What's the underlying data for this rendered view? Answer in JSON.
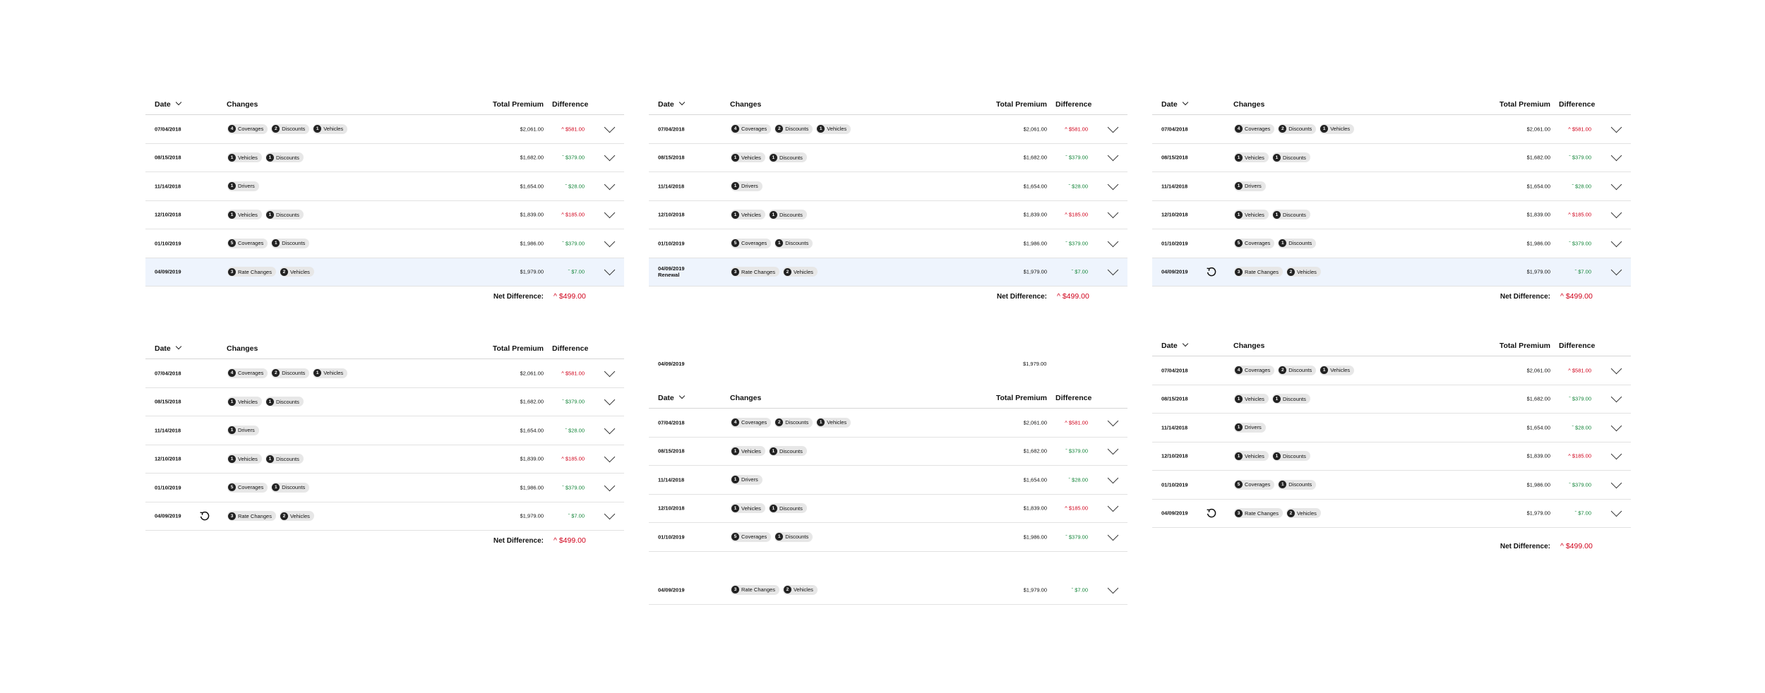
{
  "headers": {
    "date": "Date",
    "changes": "Changes",
    "total_premium": "Total Premium",
    "difference": "Difference"
  },
  "net_label": "Net Difference:",
  "colors": {
    "increase": "#d0021b",
    "decrease": "#14853a",
    "highlight_row": "#eef4fd"
  },
  "panels": [
    {
      "rows": [
        {
          "date": "07/04/2018",
          "chips": [
            {
              "n": "4",
              "label": "Coverages"
            },
            {
              "n": "2",
              "label": "Discounts"
            },
            {
              "n": "1",
              "label": "Vehicles"
            }
          ],
          "premium": "$2,061.00",
          "diff": "^ $581.00"
        },
        {
          "date": "08/15/2018",
          "chips": [
            {
              "n": "1",
              "label": "Vehicles"
            },
            {
              "n": "1",
              "label": "Discounts"
            }
          ],
          "premium": "$1,682.00",
          "diff": "ˇ $379.00"
        },
        {
          "date": "11/14/2018",
          "chips": [
            {
              "n": "1",
              "label": "Drivers"
            }
          ],
          "premium": "$1,654.00",
          "diff": "ˇ $28.00"
        },
        {
          "date": "12/10/2018",
          "chips": [
            {
              "n": "1",
              "label": "Vehicles"
            },
            {
              "n": "1",
              "label": "Discounts"
            }
          ],
          "premium": "$1,839.00",
          "diff": "^ $185.00"
        },
        {
          "date": "01/10/2019",
          "chips": [
            {
              "n": "5",
              "label": "Coverages"
            },
            {
              "n": "1",
              "label": "Discounts"
            }
          ],
          "premium": "$1,986.00",
          "diff": "ˇ $379.00"
        },
        {
          "date": "04/09/2019",
          "chips": [
            {
              "n": "3",
              "label": "Rate Changes"
            },
            {
              "n": "2",
              "label": "Vehicles"
            }
          ],
          "premium": "$1,979.00",
          "diff": "ˇ $7.00"
        }
      ],
      "net_value": "^ $499.00"
    },
    {
      "rows": [
        {
          "date": "07/04/2018",
          "chips": [
            {
              "n": "4",
              "label": "Coverages"
            },
            {
              "n": "2",
              "label": "Discounts"
            },
            {
              "n": "1",
              "label": "Vehicles"
            }
          ],
          "premium": "$2,061.00",
          "diff": "^ $581.00"
        },
        {
          "date": "08/15/2018",
          "chips": [
            {
              "n": "1",
              "label": "Vehicles"
            },
            {
              "n": "1",
              "label": "Discounts"
            }
          ],
          "premium": "$1,682.00",
          "diff": "ˇ $379.00"
        },
        {
          "date": "11/14/2018",
          "chips": [
            {
              "n": "1",
              "label": "Drivers"
            }
          ],
          "premium": "$1,654.00",
          "diff": "ˇ $28.00"
        },
        {
          "date": "12/10/2018",
          "chips": [
            {
              "n": "1",
              "label": "Vehicles"
            },
            {
              "n": "1",
              "label": "Discounts"
            }
          ],
          "premium": "$1,839.00",
          "diff": "^ $185.00"
        },
        {
          "date": "01/10/2019",
          "chips": [
            {
              "n": "5",
              "label": "Coverages"
            },
            {
              "n": "1",
              "label": "Discounts"
            }
          ],
          "premium": "$1,986.00",
          "diff": "ˇ $379.00"
        },
        {
          "date": "04/09/2019",
          "date2": "Renewal",
          "chips": [
            {
              "n": "3",
              "label": "Rate Changes"
            },
            {
              "n": "2",
              "label": "Vehicles"
            }
          ],
          "premium": "$1,979.00",
          "diff": "ˇ $7.00"
        }
      ],
      "net_value": "^ $499.00"
    },
    {
      "rows": [
        {
          "date": "07/04/2018",
          "chips": [
            {
              "n": "4",
              "label": "Coverages"
            },
            {
              "n": "2",
              "label": "Discounts"
            },
            {
              "n": "1",
              "label": "Vehicles"
            }
          ],
          "premium": "$2,061.00",
          "diff": "^ $581.00"
        },
        {
          "date": "08/15/2018",
          "chips": [
            {
              "n": "1",
              "label": "Vehicles"
            },
            {
              "n": "1",
              "label": "Discounts"
            }
          ],
          "premium": "$1,682.00",
          "diff": "ˇ $379.00"
        },
        {
          "date": "11/14/2018",
          "chips": [
            {
              "n": "1",
              "label": "Drivers"
            }
          ],
          "premium": "$1,654.00",
          "diff": "ˇ $28.00"
        },
        {
          "date": "12/10/2018",
          "chips": [
            {
              "n": "1",
              "label": "Vehicles"
            },
            {
              "n": "1",
              "label": "Discounts"
            }
          ],
          "premium": "$1,839.00",
          "diff": "^ $185.00"
        },
        {
          "date": "01/10/2019",
          "chips": [
            {
              "n": "5",
              "label": "Coverages"
            },
            {
              "n": "1",
              "label": "Discounts"
            }
          ],
          "premium": "$1,986.00",
          "diff": "ˇ $379.00"
        },
        {
          "date": "04/09/2019",
          "chips": [
            {
              "n": "3",
              "label": "Rate Changes"
            },
            {
              "n": "2",
              "label": "Vehicles"
            }
          ],
          "premium": "$1,979.00",
          "diff": "ˇ $7.00"
        }
      ],
      "net_value": "^ $499.00"
    },
    {
      "rows": [
        {
          "date": "07/04/2018",
          "chips": [
            {
              "n": "4",
              "label": "Coverages"
            },
            {
              "n": "2",
              "label": "Discounts"
            },
            {
              "n": "1",
              "label": "Vehicles"
            }
          ],
          "premium": "$2,061.00",
          "diff": "^ $581.00"
        },
        {
          "date": "08/15/2018",
          "chips": [
            {
              "n": "1",
              "label": "Vehicles"
            },
            {
              "n": "1",
              "label": "Discounts"
            }
          ],
          "premium": "$1,682.00",
          "diff": "ˇ $379.00"
        },
        {
          "date": "11/14/2018",
          "chips": [
            {
              "n": "1",
              "label": "Drivers"
            }
          ],
          "premium": "$1,654.00",
          "diff": "ˇ $28.00"
        },
        {
          "date": "12/10/2018",
          "chips": [
            {
              "n": "1",
              "label": "Vehicles"
            },
            {
              "n": "1",
              "label": "Discounts"
            }
          ],
          "premium": "$1,839.00",
          "diff": "^ $185.00"
        },
        {
          "date": "01/10/2019",
          "chips": [
            {
              "n": "5",
              "label": "Coverages"
            },
            {
              "n": "1",
              "label": "Discounts"
            }
          ],
          "premium": "$1,986.00",
          "diff": "ˇ $379.00"
        },
        {
          "date": "04/09/2019",
          "chips": [
            {
              "n": "3",
              "label": "Rate Changes"
            },
            {
              "n": "2",
              "label": "Vehicles"
            }
          ],
          "premium": "$1,979.00",
          "diff": "ˇ $7.00"
        }
      ],
      "net_value": "^ $499.00"
    },
    {
      "rows": [
        {
          "date": "07/04/2018",
          "chips": [
            {
              "n": "4",
              "label": "Coverages"
            },
            {
              "n": "2",
              "label": "Discounts"
            },
            {
              "n": "1",
              "label": "Vehicles"
            }
          ],
          "premium": "$2,061.00",
          "diff": "^ $581.00"
        },
        {
          "date": "08/15/2018",
          "chips": [
            {
              "n": "1",
              "label": "Vehicles"
            },
            {
              "n": "1",
              "label": "Discounts"
            }
          ],
          "premium": "$1,682.00",
          "diff": "ˇ $379.00"
        },
        {
          "date": "11/14/2018",
          "chips": [
            {
              "n": "1",
              "label": "Drivers"
            }
          ],
          "premium": "$1,654.00",
          "diff": "ˇ $28.00"
        },
        {
          "date": "12/10/2018",
          "chips": [
            {
              "n": "1",
              "label": "Vehicles"
            },
            {
              "n": "1",
              "label": "Discounts"
            }
          ],
          "premium": "$1,839.00",
          "diff": "^ $185.00"
        },
        {
          "date": "01/10/2019",
          "chips": [
            {
              "n": "5",
              "label": "Coverages"
            },
            {
              "n": "1",
              "label": "Discounts"
            }
          ],
          "premium": "$1,986.00",
          "diff": "ˇ $379.00"
        }
      ],
      "extra_row": {
        "date": "04/09/2019",
        "chips": [
          {
            "n": "3",
            "label": "Rate Changes"
          },
          {
            "n": "2",
            "label": "Vehicles"
          }
        ],
        "premium": "$1,979.00",
        "diff": "ˇ $7.00"
      },
      "stray_date": "04/09/2019",
      "stray_premium": "$1,979.00"
    },
    {
      "rows": [
        {
          "date": "07/04/2018",
          "chips": [
            {
              "n": "4",
              "label": "Coverages"
            },
            {
              "n": "2",
              "label": "Discounts"
            },
            {
              "n": "1",
              "label": "Vehicles"
            }
          ],
          "premium": "$2,061.00",
          "diff": "^ $581.00"
        },
        {
          "date": "08/15/2018",
          "chips": [
            {
              "n": "1",
              "label": "Vehicles"
            },
            {
              "n": "1",
              "label": "Discounts"
            }
          ],
          "premium": "$1,682.00",
          "diff": "ˇ $379.00"
        },
        {
          "date": "11/14/2018",
          "chips": [
            {
              "n": "1",
              "label": "Drivers"
            }
          ],
          "premium": "$1,654.00",
          "diff": "ˇ $28.00"
        },
        {
          "date": "12/10/2018",
          "chips": [
            {
              "n": "1",
              "label": "Vehicles"
            },
            {
              "n": "1",
              "label": "Discounts"
            }
          ],
          "premium": "$1,839.00",
          "diff": "^ $185.00"
        },
        {
          "date": "01/10/2019",
          "chips": [
            {
              "n": "5",
              "label": "Coverages"
            },
            {
              "n": "1",
              "label": "Discounts"
            }
          ],
          "premium": "$1,986.00",
          "diff": "ˇ $379.00"
        },
        {
          "date": "04/09/2019",
          "chips": [
            {
              "n": "3",
              "label": "Rate Changes"
            },
            {
              "n": "2",
              "label": "Vehicles"
            }
          ],
          "premium": "$1,979.00",
          "diff": "ˇ $7.00"
        }
      ],
      "net_value": "^ $499.00"
    }
  ]
}
